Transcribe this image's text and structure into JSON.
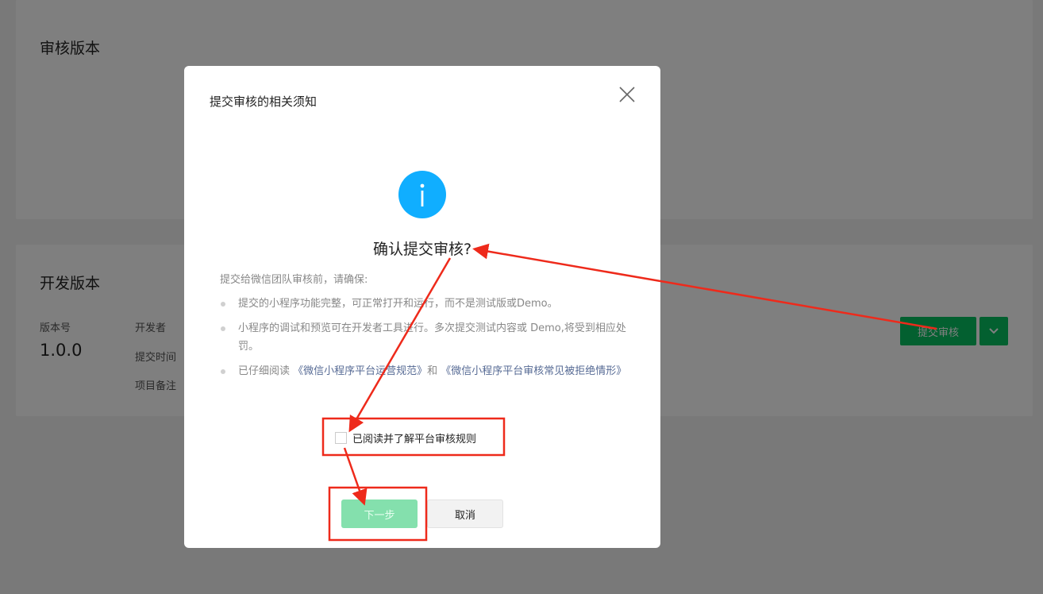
{
  "background": {
    "review_card": {
      "title": "审核版本"
    },
    "dev_card": {
      "title": "开发版本",
      "version_label": "版本号",
      "version_value": "1.0.0",
      "developer_label": "开发者",
      "submit_time_label": "提交时间",
      "note_label": "项目备注",
      "submit_button": "提交审核",
      "dropdown_icon": "chevron-down-icon"
    }
  },
  "dialog": {
    "title": "提交审核的相关须知",
    "close_icon": "close-icon",
    "info_icon": "info-icon",
    "heading": "确认提交审核?",
    "intro": "提交给微信团队审核前，请确保:",
    "rule_1": "提交的小程序功能完整，可正常打开和运行，而不是测试版或Demo。",
    "rule_2": "小程序的调试和预览可在开发者工具进行。多次提交测试内容或 Demo,将受到相应处罚。",
    "rule_3_prefix": "已仔细阅读 ",
    "rule_3_link_1": "《微信小程序平台运营规范》",
    "rule_3_middle": "和 ",
    "rule_3_link_2": "《微信小程序平台审核常见被拒绝情形》",
    "agree_label": "已阅读并了解平台审核规则",
    "next_button": "下一步",
    "cancel_button": "取消"
  },
  "colors": {
    "primary": "#07c160",
    "primary_disabled": "#84e0ad",
    "info": "#10aeff",
    "link": "#576b95",
    "annotation": "#ee2a1b"
  }
}
